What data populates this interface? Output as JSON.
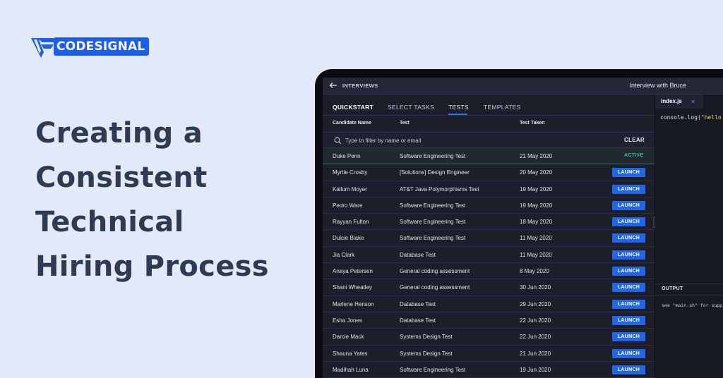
{
  "logo": {
    "text": "CODESIGNAL"
  },
  "headline": [
    "Creating a",
    "Consistent",
    "Technical",
    "Hiring Process"
  ],
  "app": {
    "breadcrumb": "INTERVIEWS",
    "title": "Interview with Bruce",
    "tabs": [
      {
        "label": "QUICKSTART"
      },
      {
        "label": "SELECT TASKS"
      },
      {
        "label": "TESTS"
      },
      {
        "label": "TEMPLATES"
      }
    ],
    "columns": {
      "name": "Candidate Name",
      "test": "Test",
      "date": "Test Taken"
    },
    "filter": {
      "placeholder": "Type to filter by name or email",
      "clear": "CLEAR"
    },
    "rows": [
      {
        "name": "Duke Penn",
        "test": "Software Engineering Test",
        "date": "21 May 2020",
        "status": "ACTIVE"
      },
      {
        "name": "Myrtle Crosby",
        "test": "[Solutions] Design Engineer",
        "date": "20 May 2020",
        "action": "LAUNCH"
      },
      {
        "name": "Kallum Moyer",
        "test": "AT&T Java Polymorphisms Test",
        "date": "19 May 2020",
        "action": "LAUNCH"
      },
      {
        "name": "Pedro Ware",
        "test": "Software Engineering Test",
        "date": "19 May 2020",
        "action": "LAUNCH"
      },
      {
        "name": "Rayyan Fulton",
        "test": "Software Engineering Test",
        "date": "18 May 2020",
        "action": "LAUNCH"
      },
      {
        "name": "Dulcie Blake",
        "test": "Software Engineering Test",
        "date": "11 May 2020",
        "action": "LAUNCH"
      },
      {
        "name": "Jia Clark",
        "test": "Database Test",
        "date": "11 May 2020",
        "action": "LAUNCH"
      },
      {
        "name": "Anaya Petersen",
        "test": "General coding assessment",
        "date": "8 May 2020",
        "action": "LAUNCH"
      },
      {
        "name": "Shani Wheatley",
        "test": "General coding assessment",
        "date": "30 Jun 2020",
        "action": "LAUNCH"
      },
      {
        "name": "Marlene Henson",
        "test": "Database Test",
        "date": "29 Jun 2020",
        "action": "LAUNCH"
      },
      {
        "name": "Esha Jones",
        "test": "Database Test",
        "date": "22 Jun 2020",
        "action": "LAUNCH"
      },
      {
        "name": "Darcie Mack",
        "test": "Systems Design Test",
        "date": "22 Jun 2020",
        "action": "LAUNCH"
      },
      {
        "name": "Shauna Yates",
        "test": "Systems Design Test",
        "date": "21 Jun 2020",
        "action": "LAUNCH"
      },
      {
        "name": "Madihah Luna",
        "test": "Software Engineering Test",
        "date": "19 Jun 2020",
        "action": "LAUNCH"
      }
    ],
    "editor": {
      "file": "index.js",
      "close": "×",
      "code_fn": "console.log(",
      "code_str": "\"hello",
      "output_label": "OUTPUT",
      "output_text": "see \"main.sh\" for supp"
    }
  },
  "colors": {
    "background": "#e3e9f8",
    "brand": "#1d5ef0",
    "headline": "#2d3b55",
    "launch": "#2166ea",
    "active": "#2fbf96"
  },
  "icons": {
    "back": "arrow-left-icon",
    "search": "search-icon",
    "close": "close-icon",
    "logo": "codesignal-logo-icon"
  }
}
